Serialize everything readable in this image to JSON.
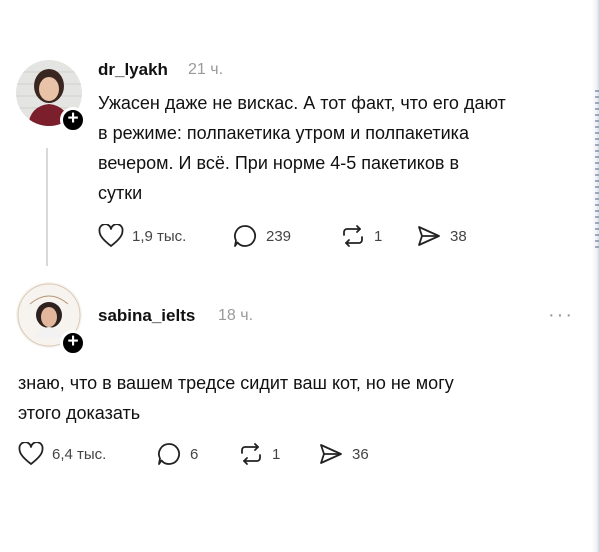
{
  "posts": [
    {
      "username": "dr_lyakh",
      "time": "21 ч.",
      "text_lines": [
        "Ужасен даже не вискас. А тот факт, что его дают",
        "в режиме: полпакетика утром и полпакетика",
        "вечером. И всё.  При норме 4-5 пакетиков в",
        "сутки"
      ],
      "actions": {
        "likes": "1,9 тыс.",
        "replies": "239",
        "reposts": "1",
        "shares": "38"
      }
    },
    {
      "username": "sabina_ielts",
      "time": "18 ч.",
      "more_label": "···",
      "text_lines": [
        "знаю, что в вашем тредсе сидит ваш кот, но не могу",
        "этого доказать"
      ],
      "actions": {
        "likes": "6,4 тыс.",
        "replies": "6",
        "reposts": "1",
        "shares": "36"
      }
    }
  ],
  "badge_label": "+",
  "colors": {
    "badge": "#000000",
    "divider": "#d9d9d9",
    "muted": "#9a9a9a"
  }
}
